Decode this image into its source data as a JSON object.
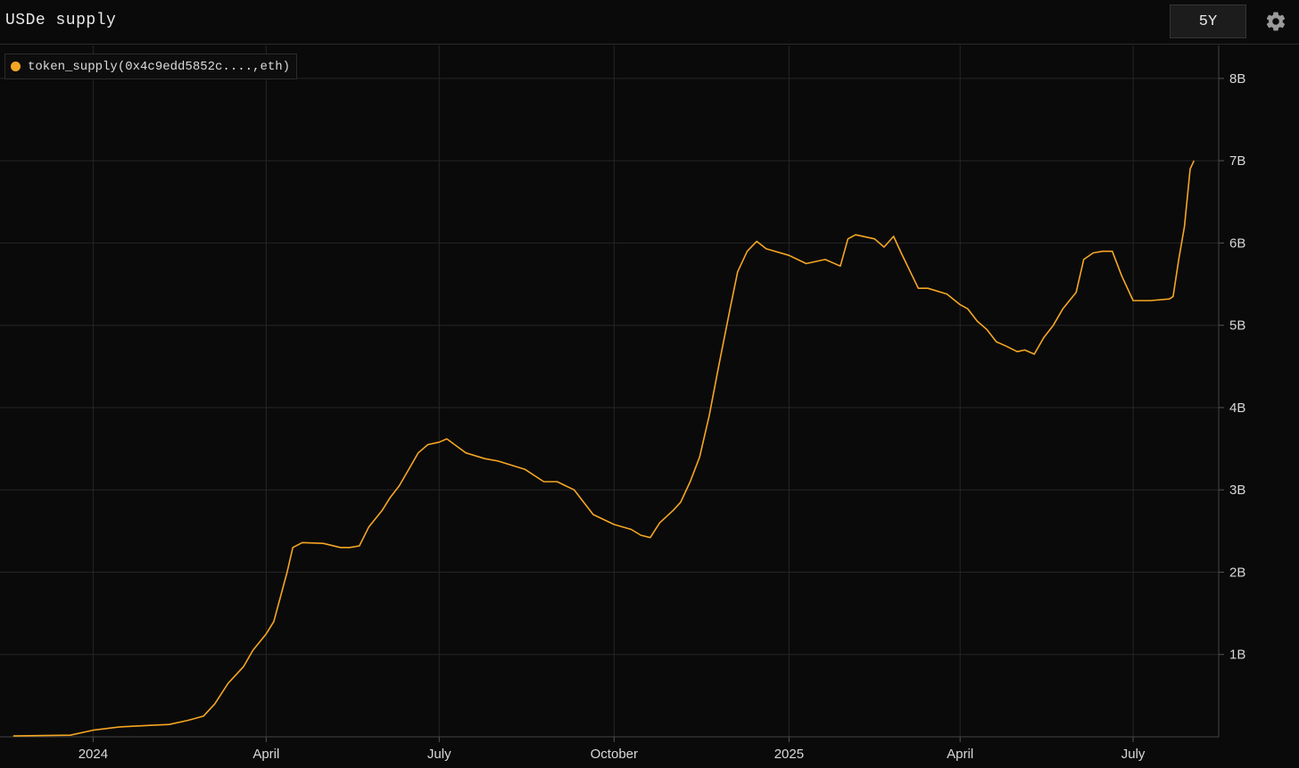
{
  "header": {
    "title": "USDe supply",
    "range_label": "5Y",
    "settings_icon": "gear-icon"
  },
  "colors": {
    "background": "#0a0a0a",
    "grid": "#262626",
    "series": "#f5a623"
  },
  "chart_data": {
    "type": "line",
    "title": "USDe supply",
    "xlabel": "",
    "ylabel": "",
    "grid": true,
    "legend_position": "top-left",
    "y_axis_position": "right",
    "xlim": [
      "2023-11-13",
      "2025-08-15"
    ],
    "ylim": [
      0,
      8.4
    ],
    "y_unit": "B",
    "yticks": [
      {
        "value": 1,
        "label": "1B"
      },
      {
        "value": 2,
        "label": "2B"
      },
      {
        "value": 3,
        "label": "3B"
      },
      {
        "value": 4,
        "label": "4B"
      },
      {
        "value": 5,
        "label": "5B"
      },
      {
        "value": 6,
        "label": "6B"
      },
      {
        "value": 7,
        "label": "7B"
      },
      {
        "value": 8,
        "label": "8B"
      }
    ],
    "xticks": [
      {
        "date": "2024-01-01",
        "label": "2024"
      },
      {
        "date": "2024-04-01",
        "label": "April"
      },
      {
        "date": "2024-07-01",
        "label": "July"
      },
      {
        "date": "2024-10-01",
        "label": "October"
      },
      {
        "date": "2025-01-01",
        "label": "2025"
      },
      {
        "date": "2025-04-01",
        "label": "April"
      },
      {
        "date": "2025-07-01",
        "label": "July"
      }
    ],
    "series": [
      {
        "name": "token_supply(0x4c9edd5852c....,eth)",
        "x": [
          "2023-11-20",
          "2023-12-20",
          "2024-01-01",
          "2024-01-15",
          "2024-02-01",
          "2024-02-10",
          "2024-02-20",
          "2024-02-28",
          "2024-03-05",
          "2024-03-12",
          "2024-03-20",
          "2024-03-25",
          "2024-04-01",
          "2024-04-05",
          "2024-04-12",
          "2024-04-15",
          "2024-04-20",
          "2024-05-01",
          "2024-05-10",
          "2024-05-15",
          "2024-05-20",
          "2024-05-25",
          "2024-06-01",
          "2024-06-05",
          "2024-06-10",
          "2024-06-15",
          "2024-06-20",
          "2024-06-25",
          "2024-07-01",
          "2024-07-05",
          "2024-07-15",
          "2024-07-25",
          "2024-08-01",
          "2024-08-15",
          "2024-08-25",
          "2024-09-01",
          "2024-09-10",
          "2024-09-20",
          "2024-10-01",
          "2024-10-10",
          "2024-10-15",
          "2024-10-20",
          "2024-10-25",
          "2024-11-01",
          "2024-11-05",
          "2024-11-10",
          "2024-11-15",
          "2024-11-20",
          "2024-11-25",
          "2024-12-01",
          "2024-12-05",
          "2024-12-10",
          "2024-12-15",
          "2024-12-20",
          "2025-01-01",
          "2025-01-10",
          "2025-01-20",
          "2025-01-28",
          "2025-02-01",
          "2025-02-05",
          "2025-02-15",
          "2025-02-20",
          "2025-02-25",
          "2025-03-01",
          "2025-03-10",
          "2025-03-15",
          "2025-03-25",
          "2025-04-01",
          "2025-04-05",
          "2025-04-10",
          "2025-04-15",
          "2025-04-20",
          "2025-04-25",
          "2025-05-01",
          "2025-05-05",
          "2025-05-10",
          "2025-05-15",
          "2025-05-20",
          "2025-05-25",
          "2025-06-01",
          "2025-06-05",
          "2025-06-10",
          "2025-06-15",
          "2025-06-20",
          "2025-06-25",
          "2025-07-01",
          "2025-07-10",
          "2025-07-20",
          "2025-07-22",
          "2025-07-25",
          "2025-07-28",
          "2025-07-31",
          "2025-08-02"
        ],
        "y": [
          0.01,
          0.02,
          0.08,
          0.12,
          0.14,
          0.15,
          0.2,
          0.25,
          0.4,
          0.65,
          0.85,
          1.05,
          1.25,
          1.4,
          2.0,
          2.3,
          2.36,
          2.35,
          2.3,
          2.3,
          2.32,
          2.55,
          2.75,
          2.9,
          3.05,
          3.25,
          3.45,
          3.55,
          3.58,
          3.62,
          3.45,
          3.38,
          3.35,
          3.25,
          3.1,
          3.1,
          3.0,
          2.7,
          2.58,
          2.52,
          2.45,
          2.42,
          2.6,
          2.75,
          2.85,
          3.1,
          3.4,
          3.9,
          4.5,
          5.2,
          5.65,
          5.9,
          6.02,
          5.93,
          5.85,
          5.75,
          5.8,
          5.72,
          6.05,
          6.1,
          6.05,
          5.95,
          6.08,
          5.88,
          5.45,
          5.45,
          5.38,
          5.25,
          5.2,
          5.05,
          4.95,
          4.8,
          4.75,
          4.68,
          4.7,
          4.65,
          4.85,
          5.0,
          5.2,
          5.4,
          5.8,
          5.88,
          5.9,
          5.9,
          5.6,
          5.3,
          5.3,
          5.32,
          5.35,
          5.8,
          6.2,
          6.9,
          7.0
        ]
      }
    ]
  }
}
